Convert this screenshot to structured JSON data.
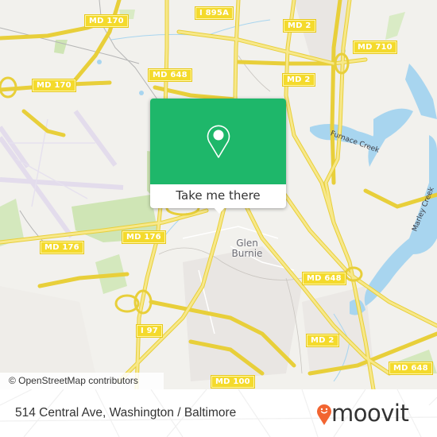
{
  "map": {
    "road_shields": [
      {
        "id": "md170-top",
        "label": "MD 170"
      },
      {
        "id": "i895a",
        "label": "I 895A"
      },
      {
        "id": "md2-top",
        "label": "MD 2"
      },
      {
        "id": "md710",
        "label": "MD 710"
      },
      {
        "id": "md648-top",
        "label": "MD 648"
      },
      {
        "id": "md2-mid",
        "label": "MD 2"
      },
      {
        "id": "md170-left",
        "label": "MD 170"
      },
      {
        "id": "md176-right",
        "label": "MD 176"
      },
      {
        "id": "md176-left",
        "label": "MD 176"
      },
      {
        "id": "md648-mid",
        "label": "MD 648"
      },
      {
        "id": "i97",
        "label": "I 97"
      },
      {
        "id": "md2-bottom",
        "label": "MD 2"
      },
      {
        "id": "md648-bottom",
        "label": "MD 648"
      },
      {
        "id": "md100",
        "label": "MD 100"
      }
    ],
    "place_labels": {
      "town": "Glen\nBurnie"
    },
    "water_labels": {
      "furnace_creek": "Furnace Creek",
      "marley_creek": "Marley Creek"
    },
    "attribution": "© OpenStreetMap contributors"
  },
  "popup": {
    "icon": "location-pin-icon",
    "cta_label": "Take me there",
    "accent_color": "#1eb76a"
  },
  "footer": {
    "address": "514 Central Ave, Washington / Baltimore",
    "brand": "moovit",
    "brand_color": "#f26531"
  }
}
